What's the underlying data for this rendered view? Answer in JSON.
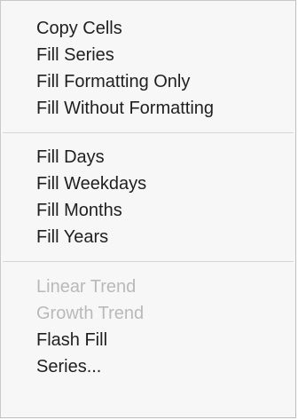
{
  "menu": {
    "section1": {
      "copy_cells": "Copy Cells",
      "fill_series": "Fill Series",
      "fill_formatting_only": "Fill Formatting Only",
      "fill_without_formatting": "Fill Without Formatting"
    },
    "section2": {
      "fill_days": "Fill Days",
      "fill_weekdays": "Fill Weekdays",
      "fill_months": "Fill Months",
      "fill_years": "Fill Years"
    },
    "section3": {
      "linear_trend": "Linear Trend",
      "growth_trend": "Growth Trend",
      "flash_fill": "Flash Fill",
      "series": "Series..."
    },
    "colors": {
      "text": "#1f1f1f",
      "disabled_text": "#b9b9b9",
      "background": "#f7f7f7",
      "separator": "#d5d5d5"
    }
  }
}
